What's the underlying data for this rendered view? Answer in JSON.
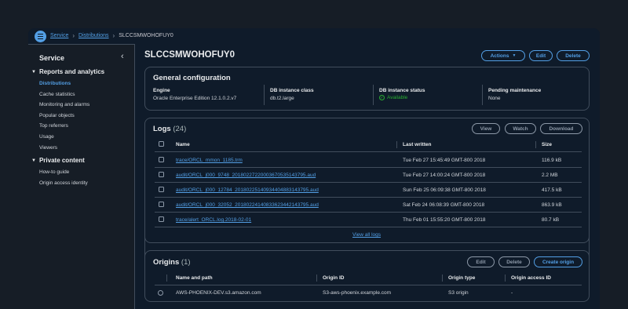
{
  "breadcrumb": [
    "Service",
    "Distributions",
    "SLCCSMWOHOFUY0"
  ],
  "sidebar": {
    "title": "Service",
    "sections": [
      {
        "label": "Reports and analytics",
        "items": [
          "Distributions",
          "Cache statistics",
          "Monitoring and alarms",
          "Popular objects",
          "Top referrers",
          "Usage",
          "Viewers"
        ],
        "active": "Distributions"
      },
      {
        "label": "Private content",
        "items": [
          "How-to guide",
          "Origin access identity"
        ]
      }
    ]
  },
  "page": {
    "title": "SLCCSMWOHOFUY0",
    "actions_label": "Actions",
    "edit_label": "Edit",
    "delete_label": "Delete"
  },
  "general": {
    "title": "General configuration",
    "fields": [
      {
        "label": "Engine",
        "value": "Oracle Enterprise Edition 12.1.0.2.v7"
      },
      {
        "label": "DB instance class",
        "value": "db.t2.large"
      },
      {
        "label": "DB instance status",
        "value": "Available"
      },
      {
        "label": "Pending maintenance",
        "value": "None"
      }
    ]
  },
  "logs": {
    "title": "Logs",
    "count": "(24)",
    "buttons": [
      "View",
      "Watch",
      "Download"
    ],
    "columns": [
      "Name",
      "Last written",
      "Size"
    ],
    "rows": [
      {
        "name": "trace/ORCL_mmon_1185.trm",
        "last_written": "Tue Feb 27 15:45:49 GMT-800 2018",
        "size": "116.9 kB"
      },
      {
        "name": "audit/ORCL_j000_9748_20180227220003670535143795.aud",
        "last_written": "Tue Feb 27 14:00:24 GMT-800 2018",
        "size": "2.2 MB"
      },
      {
        "name": "audit/ORCL_j000_12784_20180225140934404883143795.aud",
        "last_written": "Sun Feb 25 06:09:38 GMT-800 2018",
        "size": "417.5 kB"
      },
      {
        "name": "audit/ORCL_j000_32052_20180224140833623442143795.aud",
        "last_written": "Sat Feb 24 06:08:39 GMT-800 2018",
        "size": "863.9 kB"
      },
      {
        "name": "trace/alert_ORCL.log.2018-02-01",
        "last_written": "Thu Feb 01 15:55:20 GMT-800 2018",
        "size": "80.7 kB"
      }
    ],
    "view_all": "View all logs"
  },
  "origins": {
    "title": "Origins",
    "count": "(1)",
    "buttons": [
      "Edit",
      "Delete",
      "Create origin"
    ],
    "columns": [
      "Name and path",
      "Origin ID",
      "Origin type",
      "Origin access ID"
    ],
    "rows": [
      {
        "name": "AWS-PHOENIX-DEV.s3.amazon.com",
        "origin_id": "S3-aws-phoenix.example.com",
        "type": "S3 origin",
        "access_id": "-"
      }
    ]
  },
  "colors": {
    "accent": "#539fe5",
    "success": "#29ad32",
    "background": "#0f1b2a",
    "border": "#414d5c"
  }
}
